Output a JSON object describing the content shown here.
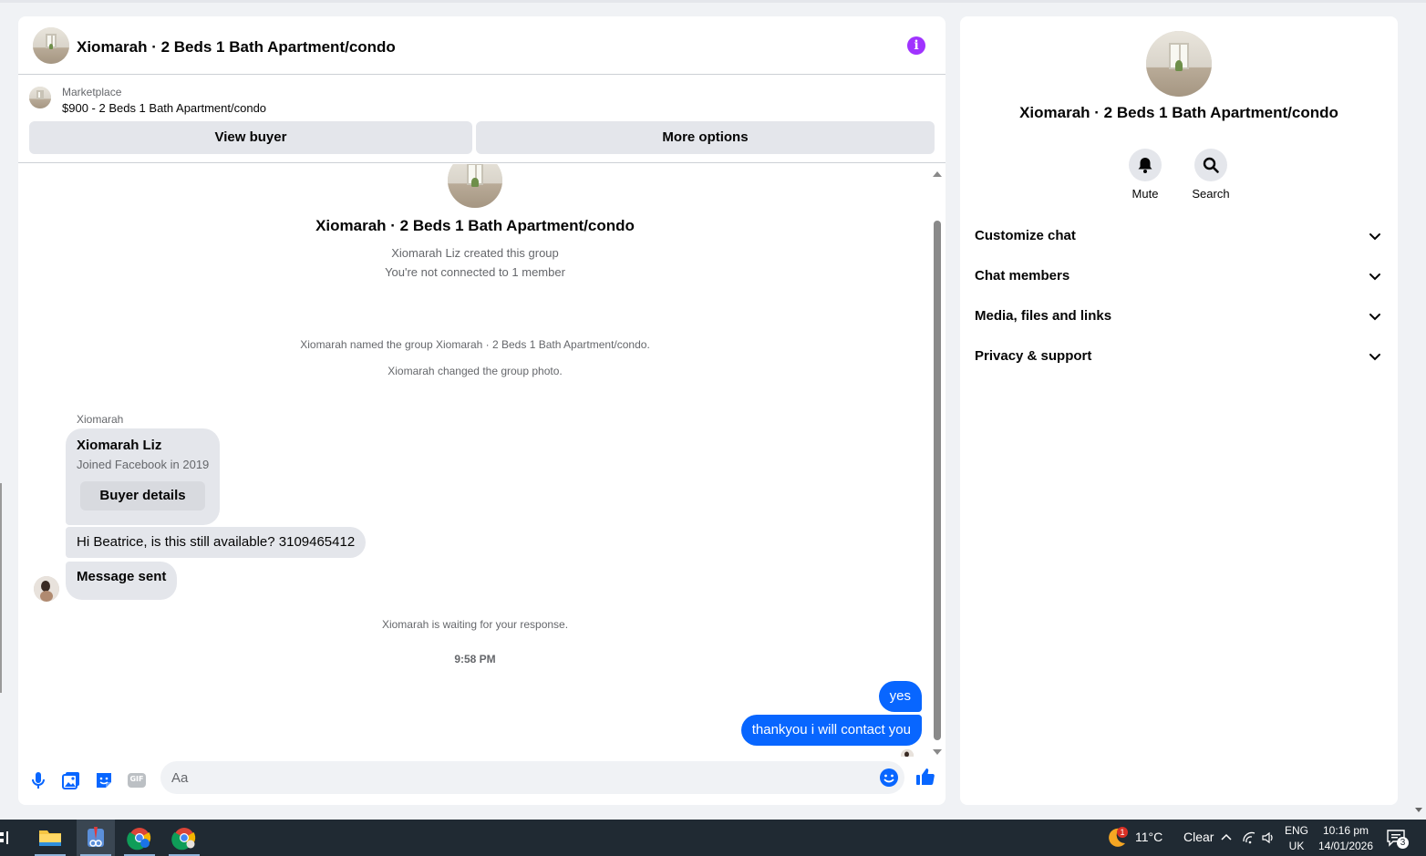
{
  "chat": {
    "title": "Xiomarah · 2 Beds 1 Bath Apartment/condo",
    "marketplace": {
      "label": "Marketplace",
      "listing": "$900 - 2 Beds 1 Bath Apartment/condo",
      "view_buyer": "View buyer",
      "more_options": "More options"
    },
    "thread": {
      "title": "Xiomarah · 2 Beds 1 Bath Apartment/condo",
      "created": "Xiomarah Liz created this group",
      "not_connected": "You're not connected to 1 member",
      "named_group": "Xiomarah named the group Xiomarah · 2 Beds 1 Bath Apartment/condo.",
      "changed_photo": "Xiomarah changed the group photo.",
      "sender_label": "Xiomarah",
      "card": {
        "name": "Xiomarah Liz",
        "joined": "Joined Facebook in 2019",
        "button": "Buyer details"
      },
      "message_1": "Hi Beatrice, is this still available? 3109465412",
      "message_2": "Message sent",
      "waiting": "Xiomarah is waiting for your response.",
      "time": "9:58 PM",
      "reply_1": "yes",
      "reply_2": "thankyou i will contact you"
    },
    "composer": {
      "placeholder": "Aa",
      "icons": [
        "microphone-icon",
        "photo-icon",
        "sticker-icon",
        "gif-icon",
        "emoji-icon",
        "thumbs-up-icon"
      ],
      "gif_label": "GIF"
    },
    "colors": {
      "accent": "#0866ff",
      "info": "#a033ff",
      "bubble_in": "#e4e6eb"
    }
  },
  "info_panel": {
    "title": "Xiomarah · 2 Beds 1 Bath Apartment/condo",
    "actions": [
      {
        "label": "Mute",
        "icon": "bell-icon"
      },
      {
        "label": "Search",
        "icon": "search-icon"
      }
    ],
    "sections": [
      {
        "label": "Customize chat"
      },
      {
        "label": "Chat members"
      },
      {
        "label": "Media, files and links"
      },
      {
        "label": "Privacy & support"
      }
    ]
  },
  "taskbar": {
    "apps": [
      "file-explorer",
      "snipping-tool",
      "chrome-profile-h",
      "chrome"
    ],
    "weather": {
      "temp": "11°C",
      "condition": "Clear",
      "badge": "1"
    },
    "language": {
      "line1": "ENG",
      "line2": "UK"
    },
    "clock": {
      "time": "10:16 pm",
      "date": "14/01/2026"
    },
    "notifications": "3"
  }
}
